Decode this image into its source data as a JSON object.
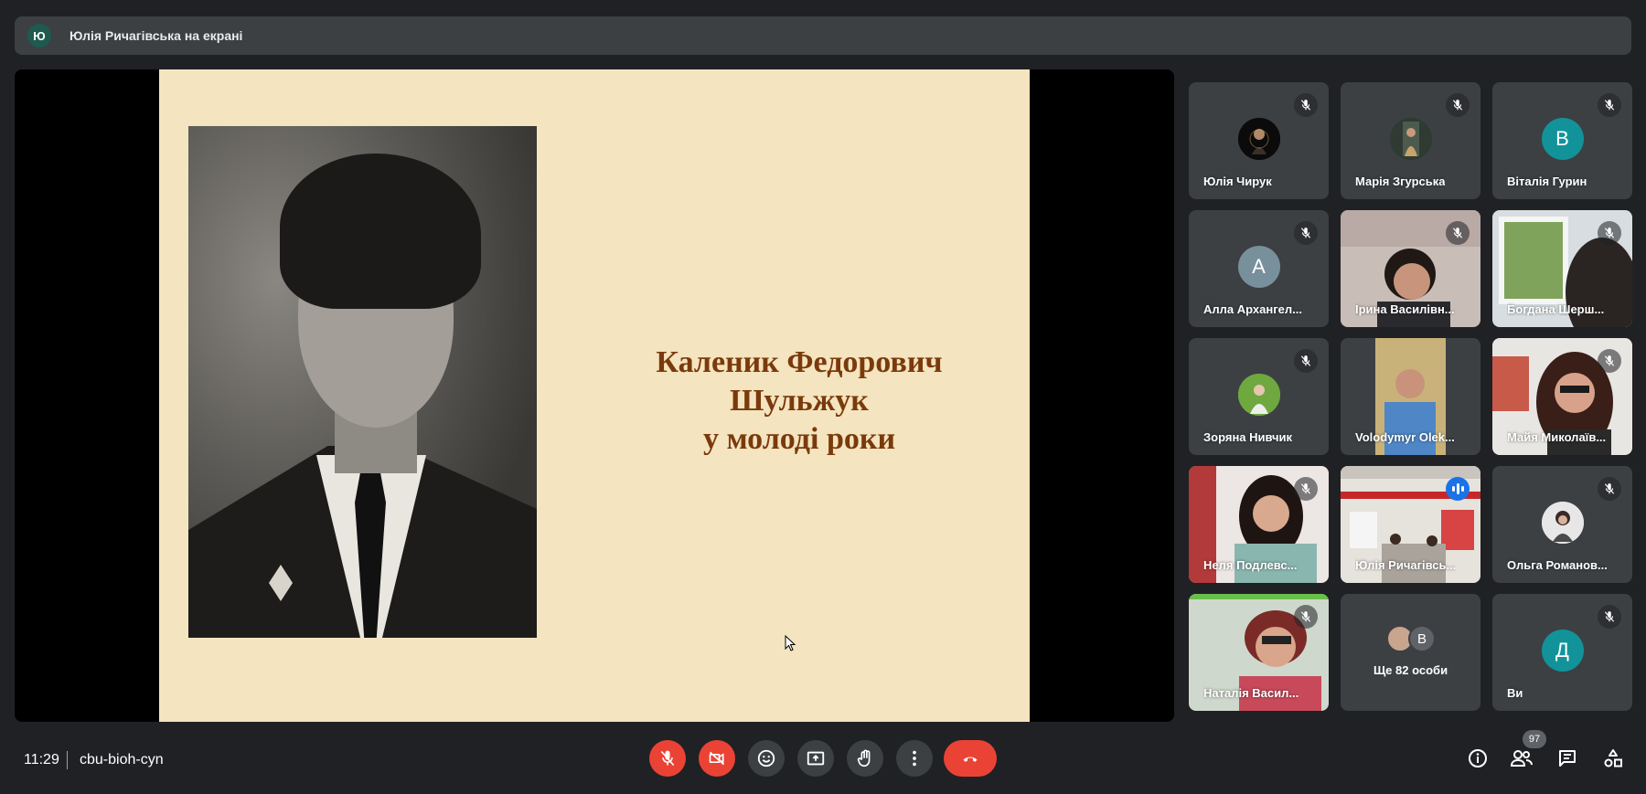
{
  "presenter": {
    "initial": "Ю",
    "banner": "Юлія Ричагівська на екрані"
  },
  "slide": {
    "title_lines": [
      "Каленик Федорович",
      "Шульжук",
      "у молоді роки"
    ]
  },
  "participants": [
    {
      "name": "Юлія Чирук",
      "muted": true,
      "avatar": "photo"
    },
    {
      "name": "Марія Згурська",
      "muted": true,
      "avatar": "photo"
    },
    {
      "name": "Віталія Гурин",
      "muted": true,
      "initial": "В",
      "color": "#12939a"
    },
    {
      "name": "Алла Архангел...",
      "muted": true,
      "initial": "А",
      "color": "#78909c"
    },
    {
      "name": "Ірина Василівн...",
      "muted": true,
      "avatar": "video"
    },
    {
      "name": "Богдана Шерш...",
      "muted": true,
      "avatar": "video"
    },
    {
      "name": "Зоряна Нивчик",
      "muted": true,
      "avatar": "photo"
    },
    {
      "name": "Volodymyr Olek...",
      "muted": false,
      "avatar": "video"
    },
    {
      "name": "Майя Миколаїв...",
      "muted": true,
      "avatar": "video"
    },
    {
      "name": "Неля Подлевс...",
      "muted": true,
      "avatar": "video"
    },
    {
      "name": "Юлія Ричагівсь...",
      "muted": false,
      "speaking": true,
      "avatar": "video"
    },
    {
      "name": "Ольга Романов...",
      "muted": true,
      "avatar": "photo"
    },
    {
      "name": "Наталія Васил...",
      "muted": true,
      "avatar": "video"
    },
    {
      "name": "Ще 82 особи",
      "muted": false,
      "initial": "В",
      "color": "#5f6368"
    },
    {
      "name": "Ви",
      "muted": true,
      "initial": "Д",
      "color": "#12939a"
    }
  ],
  "meeting": {
    "time": "11:29",
    "code": "cbu-bioh-cyn",
    "people_count": "97"
  },
  "colors": {
    "danger": "#ea4335",
    "slide_bg": "#f4e4bf",
    "slide_title": "#7a3a0c"
  }
}
